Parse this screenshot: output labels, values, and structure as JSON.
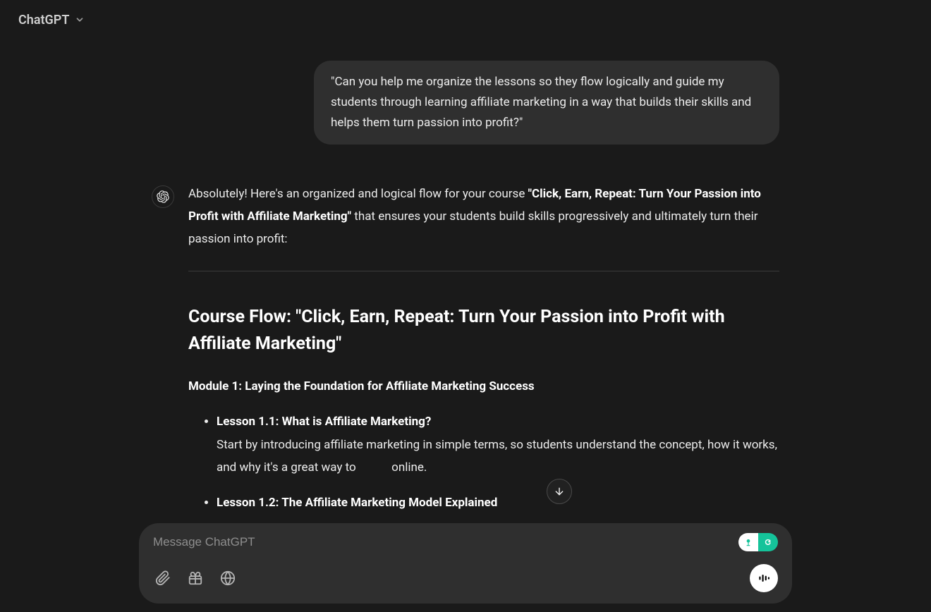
{
  "header": {
    "model_label": "ChatGPT"
  },
  "conversation": {
    "user_message": "\"Can you help me organize the lessons so they flow logically and guide my students through learning affiliate marketing in a way that builds their skills and helps them turn passion into profit?\"",
    "assistant": {
      "intro_before_bold": "Absolutely! Here's an organized and logical flow for your course ",
      "intro_bold": "\"Click, Earn, Repeat: Turn Your Passion into Profit with Affiliate Marketing\"",
      "intro_after_bold": " that ensures your students build skills progressively and ultimately turn their passion into profit:",
      "heading": "Course Flow: \"Click, Earn, Repeat: Turn Your Passion into Profit with Affiliate Marketing\"",
      "module_title": "Module 1: Laying the Foundation for Affiliate Marketing Success",
      "lessons": [
        {
          "title": "Lesson 1.1: What is Affiliate Marketing?",
          "desc_before": "Start by introducing affiliate marketing in simple terms, so students understand the concept, how it works, and why it's a great way to ",
          "desc_after": " online."
        },
        {
          "title": "Lesson 1.2: The Affiliate Marketing Model Explained",
          "desc_before": "",
          "desc_after": ""
        }
      ]
    }
  },
  "composer": {
    "placeholder": "Message ChatGPT"
  }
}
